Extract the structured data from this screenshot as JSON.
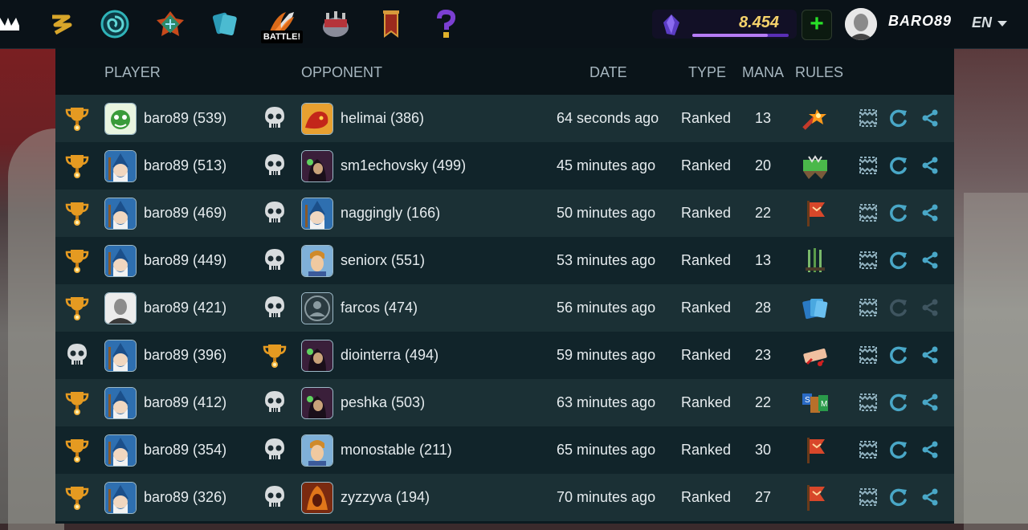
{
  "nav": {
    "battle_label": "BATTLE!",
    "dec_balance": "8.454",
    "dec_progress": 0.78,
    "plus_label": "+",
    "username": "BARO89",
    "language": "EN"
  },
  "headers": {
    "player": "PLAYER",
    "opponent": "OPPONENT",
    "date": "DATE",
    "type": "TYPE",
    "mana": "MANA",
    "rules": "RULES"
  },
  "rows": [
    {
      "player": "baro89 (539)",
      "player_result": "win",
      "player_avatar": "green-monster",
      "opponent": "helimai (386)",
      "opponent_result": "loss",
      "opponent_avatar": "red-dragon",
      "date": "64 seconds ago",
      "type": "Ranked",
      "mana": "13",
      "rule": "explosive-weaponry-icon",
      "actions_enabled": true
    },
    {
      "player": "baro89 (513)",
      "player_result": "win",
      "player_avatar": "blue-wizard",
      "opponent": "sm1echovsky (499)",
      "opponent_result": "loss",
      "opponent_avatar": "dark-mage",
      "date": "45 minutes ago",
      "type": "Ranked",
      "mana": "20",
      "rule": "earthquake-icon",
      "actions_enabled": true
    },
    {
      "player": "baro89 (469)",
      "player_result": "win",
      "player_avatar": "blue-wizard",
      "opponent": "naggingly (166)",
      "opponent_result": "loss",
      "opponent_avatar": "blue-wizard",
      "date": "50 minutes ago",
      "type": "Ranked",
      "mana": "22",
      "rule": "standard-banner-icon",
      "actions_enabled": true
    },
    {
      "player": "baro89 (449)",
      "player_result": "win",
      "player_avatar": "blue-wizard",
      "opponent": "seniorx (551)",
      "opponent_result": "loss",
      "opponent_avatar": "cartoon-hero",
      "date": "53 minutes ago",
      "type": "Ranked",
      "mana": "13",
      "rule": "melee-mayhem-icon",
      "actions_enabled": true
    },
    {
      "player": "baro89 (421)",
      "player_result": "win",
      "player_avatar": "bald-man-photo",
      "opponent": "farcos (474)",
      "opponent_result": "loss",
      "opponent_avatar": "default-user",
      "date": "56 minutes ago",
      "type": "Ranked",
      "mana": "28",
      "rule": "card-deck-icon",
      "actions_enabled": false
    },
    {
      "player": "baro89 (396)",
      "player_result": "loss",
      "player_avatar": "blue-wizard",
      "opponent": "diointerra (494)",
      "opponent_result": "win",
      "opponent_avatar": "dark-mage",
      "date": "59 minutes ago",
      "type": "Ranked",
      "mana": "23",
      "rule": "broken-arrows-icon",
      "actions_enabled": true
    },
    {
      "player": "baro89 (412)",
      "player_result": "win",
      "player_avatar": "blue-wizard",
      "opponent": "peshka (503)",
      "opponent_result": "loss",
      "opponent_avatar": "dark-mage",
      "date": "63 minutes ago",
      "type": "Ranked",
      "mana": "22",
      "rule": "spreading-fury-icon",
      "actions_enabled": true
    },
    {
      "player": "baro89 (354)",
      "player_result": "win",
      "player_avatar": "blue-wizard",
      "opponent": "monostable (211)",
      "opponent_result": "loss",
      "opponent_avatar": "cartoon-hero",
      "date": "65 minutes ago",
      "type": "Ranked",
      "mana": "30",
      "rule": "standard-banner-icon",
      "actions_enabled": true
    },
    {
      "player": "baro89 (326)",
      "player_result": "win",
      "player_avatar": "blue-wizard",
      "opponent": "zyzzyva (194)",
      "opponent_result": "loss",
      "opponent_avatar": "fire-warrior",
      "date": "70 minutes ago",
      "type": "Ranked",
      "mana": "27",
      "rule": "standard-banner-icon",
      "actions_enabled": true
    }
  ]
}
